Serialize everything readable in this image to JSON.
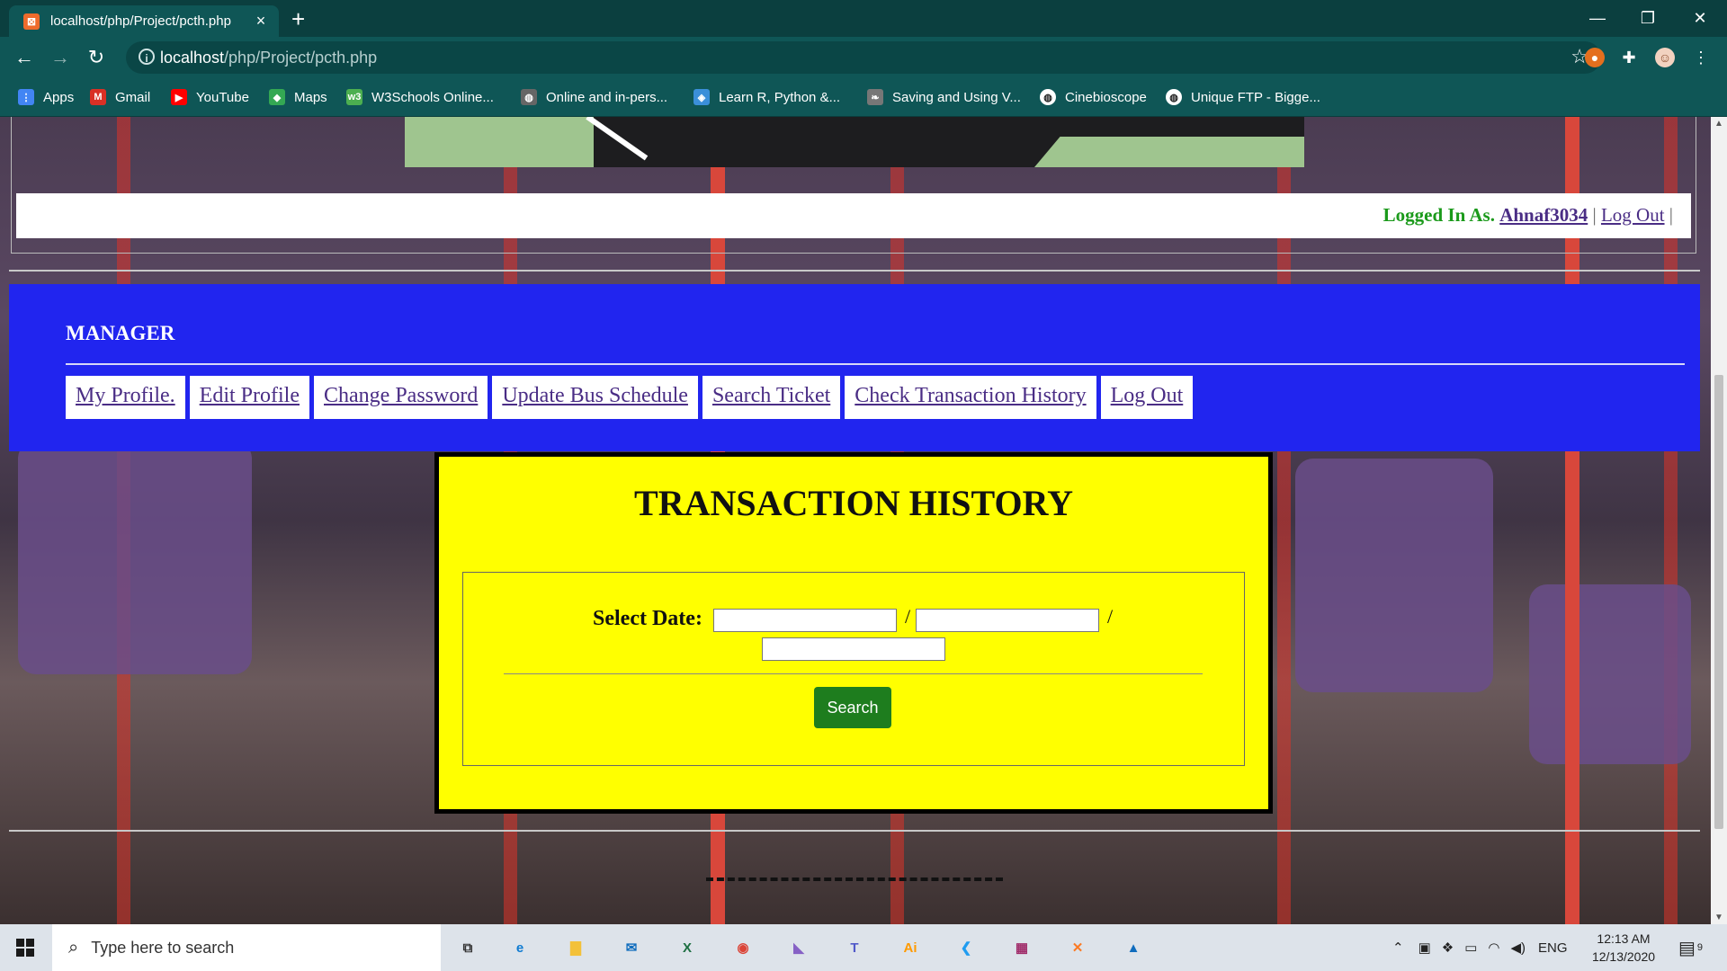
{
  "browser": {
    "tab_title": "localhost/php/Project/pcth.php",
    "tab_close": "×",
    "new_tab": "+",
    "url_host": "localhost",
    "url_path": "/php/Project/pcth.php",
    "back": "←",
    "forward": "→",
    "reload": "↻",
    "star": "☆",
    "window_controls": [
      "—",
      "❐",
      "✕"
    ],
    "bookmarks": [
      {
        "label": "Apps",
        "icon": "apps-grid-icon",
        "color": "#4285f4"
      },
      {
        "label": "Gmail",
        "icon": "gmail-icon",
        "color": "#d93025"
      },
      {
        "label": "YouTube",
        "icon": "youtube-icon",
        "color": "#ff0000"
      },
      {
        "label": "Maps",
        "icon": "maps-icon",
        "color": "#34a853"
      },
      {
        "label": "W3Schools Online...",
        "icon": "w3schools-icon",
        "color": "#4caf50"
      },
      {
        "label": "Online and in-pers...",
        "icon": "globe-icon",
        "color": "#666666"
      },
      {
        "label": "Learn R, Python &...",
        "icon": "shield-icon",
        "color": "#3b8fd9"
      },
      {
        "label": "Saving and Using V...",
        "icon": "leaf-icon",
        "color": "#777777"
      },
      {
        "label": "Cinebioscope",
        "icon": "globe-icon",
        "color": "#222222"
      },
      {
        "label": "Unique FTP - Bigge...",
        "icon": "globe-icon",
        "color": "#222222"
      }
    ]
  },
  "page": {
    "login_label": "Logged In As.",
    "login_user": "Ahnaf3034",
    "login_sep": "|",
    "login_logout": "Log Out",
    "login_sep2": "|",
    "role": "MANAGER",
    "menu": [
      "My Profile.",
      "Edit Profile",
      "Change Password",
      "Update Bus Schedule",
      "Search Ticket",
      "Check Transaction History",
      "Log Out"
    ],
    "panel_title": "TRANSACTION HISTORY",
    "date_label": "Select Date:",
    "date_sep": "/",
    "date_day": "",
    "date_month": "",
    "date_year": "",
    "search_button": "Search",
    "colors": {
      "manager_bar": "#2125ef",
      "panel": "#ffff00",
      "login_green": "#1b9a1b",
      "search_green": "#1e7d1e"
    }
  },
  "taskbar": {
    "search_placeholder": "Type here to search",
    "apps": [
      {
        "name": "task-view-icon",
        "glyph": "⧉",
        "color": "#333333"
      },
      {
        "name": "edge-icon",
        "glyph": "e",
        "color": "#0f7bd1"
      },
      {
        "name": "file-explorer-icon",
        "glyph": "▇",
        "color": "#f3c13a"
      },
      {
        "name": "mail-icon",
        "glyph": "✉",
        "color": "#0f6cbd"
      },
      {
        "name": "excel-icon",
        "glyph": "X",
        "color": "#1d6f42"
      },
      {
        "name": "chrome-icon",
        "glyph": "◉",
        "color": "#db4437"
      },
      {
        "name": "visual-studio-icon",
        "glyph": "◣",
        "color": "#8661c5"
      },
      {
        "name": "teams-icon",
        "glyph": "T",
        "color": "#5059c9"
      },
      {
        "name": "illustrator-icon",
        "glyph": "Ai",
        "color": "#ff9a00"
      },
      {
        "name": "vscode-icon",
        "glyph": "❮",
        "color": "#1f9cf0"
      },
      {
        "name": "winrar-icon",
        "glyph": "▦",
        "color": "#a02c6a"
      },
      {
        "name": "xampp-icon",
        "glyph": "✕",
        "color": "#fb7a24"
      },
      {
        "name": "photos-icon",
        "glyph": "▲",
        "color": "#0f6cbd"
      }
    ],
    "lang": "ENG",
    "time": "12:13 AM",
    "date": "12/13/2020",
    "notifications": "9"
  }
}
